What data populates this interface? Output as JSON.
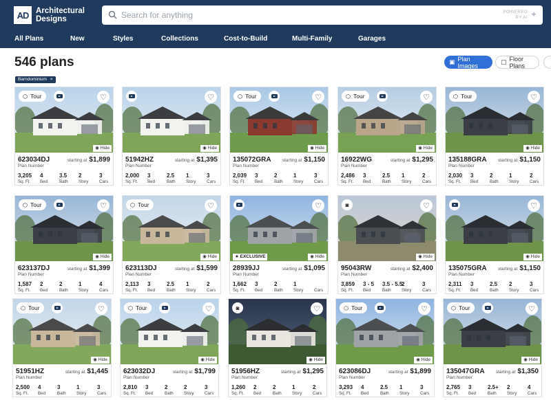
{
  "header": {
    "logo_mark": "AD",
    "logo_line1": "Architectural",
    "logo_line2": "Designs",
    "search_placeholder": "Search for anything",
    "powered_line1": "POWERED",
    "powered_line2": "BY AI"
  },
  "nav": [
    "All Plans",
    "New",
    "Styles",
    "Collections",
    "Cost-to-Build",
    "Multi-Family",
    "Garages"
  ],
  "results": {
    "count": "546 plans",
    "filter_chip": "Barndominium",
    "view_images": "Plan Images",
    "view_floor": "Floor Plans"
  },
  "labels": {
    "plan_number": "Plan Number",
    "starting_at": "starting at",
    "hide": "Hide",
    "tour": "Tour",
    "sqft": "Sq. Ft.",
    "bed": "Bed",
    "bath": "Bath",
    "story": "Story",
    "cars": "Cars"
  },
  "colors": {
    "brand_navy": "#1f3a5c",
    "accent_blue": "#2f6fd6"
  },
  "plans": [
    {
      "id": "623034DJ",
      "price": "$1,899",
      "sqft": "3,205",
      "bed": "4",
      "bath": "3.5",
      "story": "2",
      "cars": "3",
      "tour": true,
      "video": true,
      "photo": false,
      "exclusive": false,
      "scene": "white"
    },
    {
      "id": "51942HZ",
      "price": "$1,395",
      "sqft": "2,000",
      "bed": "3",
      "bath": "2.5",
      "story": "1",
      "cars": "3",
      "tour": false,
      "video": true,
      "photo": false,
      "exclusive": false,
      "scene": "white"
    },
    {
      "id": "135072GRA",
      "price": "$1,150",
      "sqft": "2,039",
      "bed": "3",
      "bath": "2",
      "story": "1",
      "cars": "3",
      "tour": true,
      "video": true,
      "photo": false,
      "exclusive": false,
      "scene": "red"
    },
    {
      "id": "16922WG",
      "price": "$1,295",
      "sqft": "2,486",
      "bed": "3",
      "bath": "2.5",
      "story": "1",
      "cars": "2",
      "tour": true,
      "video": true,
      "photo": false,
      "exclusive": false,
      "scene": "stone"
    },
    {
      "id": "135188GRA",
      "price": "$1,150",
      "sqft": "2,030",
      "bed": "3",
      "bath": "2",
      "story": "1",
      "cars": "2",
      "tour": true,
      "video": false,
      "photo": false,
      "exclusive": false,
      "scene": "dark"
    },
    {
      "id": "623137DJ",
      "price": "$1,399",
      "sqft": "1,587",
      "bed": "2",
      "bath": "2",
      "story": "1",
      "cars": "4",
      "tour": true,
      "video": true,
      "photo": false,
      "exclusive": false,
      "scene": "dark"
    },
    {
      "id": "623113DJ",
      "price": "$1,599",
      "sqft": "2,113",
      "bed": "3",
      "bath": "2.5",
      "story": "1",
      "cars": "2",
      "tour": true,
      "video": false,
      "photo": false,
      "exclusive": false,
      "scene": "tan"
    },
    {
      "id": "28939JJ",
      "price": "$1,095",
      "sqft": "1,662",
      "bed": "3",
      "bath": "2",
      "story": "1",
      "cars": "",
      "tour": false,
      "video": true,
      "photo": false,
      "exclusive": true,
      "exclusive_label": "EXCLUSIVE",
      "scene": "gray"
    },
    {
      "id": "95043RW",
      "price": "$2,400",
      "sqft": "3,859",
      "bed": "3 - 5",
      "bath": "3.5 - 5.5",
      "story": "2",
      "cars": "3",
      "tour": false,
      "video": false,
      "photo": true,
      "exclusive": false,
      "scene": "modern"
    },
    {
      "id": "135075GRA",
      "price": "$1,150",
      "sqft": "2,311",
      "bed": "3",
      "bath": "2.5",
      "story": "2",
      "cars": "3",
      "tour": false,
      "video": true,
      "photo": false,
      "exclusive": false,
      "scene": "dark"
    },
    {
      "id": "51951HZ",
      "price": "$1,445",
      "sqft": "2,500",
      "bed": "4",
      "bath": "3",
      "story": "1",
      "cars": "3",
      "tour": true,
      "video": true,
      "photo": false,
      "exclusive": false,
      "scene": "tan"
    },
    {
      "id": "623032DJ",
      "price": "$1,799",
      "sqft": "2,810",
      "bed": "3",
      "bath": "2",
      "story": "2",
      "cars": "3",
      "tour": true,
      "video": true,
      "photo": false,
      "exclusive": false,
      "scene": "white"
    },
    {
      "id": "51956HZ",
      "price": "$1,295",
      "sqft": "1,260",
      "bed": "2",
      "bath": "2",
      "story": "1",
      "cars": "2",
      "tour": false,
      "video": false,
      "photo": true,
      "exclusive": false,
      "scene": "night"
    },
    {
      "id": "623086DJ",
      "price": "$1,899",
      "sqft": "3,293",
      "bed": "4",
      "bath": "2.5",
      "story": "1",
      "cars": "3",
      "tour": true,
      "video": true,
      "photo": false,
      "exclusive": false,
      "scene": "gray"
    },
    {
      "id": "135047GRA",
      "price": "$1,350",
      "sqft": "2,765",
      "bed": "3",
      "bath": "2.5+",
      "story": "2",
      "cars": "4",
      "tour": true,
      "video": true,
      "photo": false,
      "exclusive": false,
      "scene": "dark"
    }
  ]
}
